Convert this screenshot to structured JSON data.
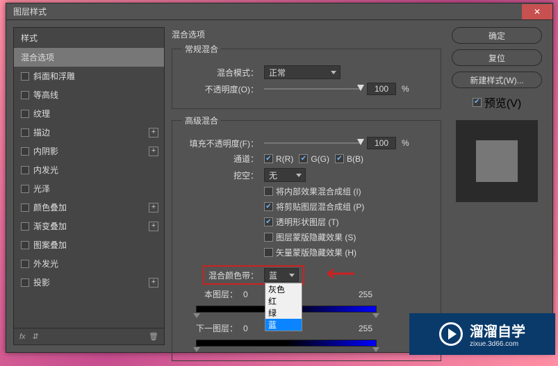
{
  "window": {
    "title": "图层样式"
  },
  "sidebar": {
    "header": "样式",
    "selected_label": "混合选项",
    "items": [
      {
        "label": "斜面和浮雕",
        "plus": false
      },
      {
        "label": "等高线",
        "plus": false
      },
      {
        "label": "纹理",
        "plus": false
      },
      {
        "label": "描边",
        "plus": true
      },
      {
        "label": "内阴影",
        "plus": true
      },
      {
        "label": "内发光",
        "plus": false
      },
      {
        "label": "光泽",
        "plus": false
      },
      {
        "label": "颜色叠加",
        "plus": true
      },
      {
        "label": "渐变叠加",
        "plus": true
      },
      {
        "label": "图案叠加",
        "plus": false
      },
      {
        "label": "外发光",
        "plus": false
      },
      {
        "label": "投影",
        "plus": true
      }
    ],
    "footer_fx": "fx"
  },
  "main": {
    "title": "混合选项",
    "general": {
      "legend": "常规混合",
      "mode_label": "混合模式：",
      "mode_value": "正常",
      "opacity_label": "不透明度(O)：",
      "opacity_value": "100",
      "opacity_unit": "%"
    },
    "advanced": {
      "legend": "高级混合",
      "fill_label": "填充不透明度(F)：",
      "fill_value": "100",
      "fill_unit": "%",
      "channels_label": "通道：",
      "r": "R(R)",
      "g": "G(G)",
      "b": "B(B)",
      "knockout_label": "挖空：",
      "knockout_value": "无",
      "cb1": "将内部效果混合成组 (I)",
      "cb2": "将剪贴图层混合成组 (P)",
      "cb3": "透明形状图层 (T)",
      "cb4": "图层蒙版隐藏效果 (S)",
      "cb5": "矢量蒙版隐藏效果 (H)",
      "blendif_label": "混合颜色带：",
      "blendif_value": "蓝",
      "dropdown": [
        "灰色",
        "红",
        "绿",
        "蓝"
      ],
      "this_label": "本图层：",
      "this_low": "0",
      "this_high": "255",
      "under_label": "下一图层：",
      "under_low": "0",
      "under_high": "255"
    }
  },
  "buttons": {
    "ok": "确定",
    "cancel": "复位",
    "newstyle": "新建样式(W)...",
    "preview": "预览(V)"
  },
  "watermark": {
    "big": "溜溜自学",
    "small": "zixue.3d66.com"
  }
}
